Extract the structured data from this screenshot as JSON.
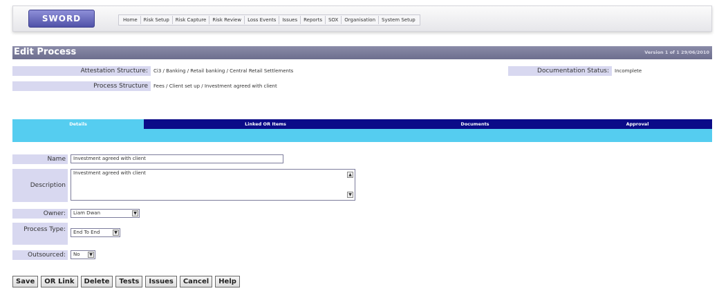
{
  "header": {
    "logo": "SWORD",
    "nav": [
      "Home",
      "Risk Setup",
      "Risk Capture",
      "Risk Review",
      "Loss Events",
      "Issues",
      "Reports",
      "SOX",
      "Organisation",
      "System Setup"
    ]
  },
  "page": {
    "title": "Edit Process",
    "version": "Version 1 of 1 29/06/2010"
  },
  "info": {
    "attestation_label": "Attestation Structure:",
    "attestation_value": "Ci3 / Banking / Retail banking / Central Retail Settlements",
    "process_label": "Process Structure",
    "process_value": "Fees / Client set up / Investment agreed with client",
    "doc_status_label": "Documentation Status:",
    "doc_status_value": "Incomplete"
  },
  "tabs": [
    "Details",
    "Linked OR Items",
    "Documents",
    "Approval"
  ],
  "form": {
    "name_label": "Name",
    "name_value": "Investment agreed with client",
    "description_label": "Description",
    "description_value": "Investment agreed with client",
    "owner_label": "Owner:",
    "owner_value": "Liam Dwan",
    "process_type_label": "Process Type:",
    "process_type_value": "End To End",
    "outsourced_label": "Outsourced:",
    "outsourced_value": "No"
  },
  "buttons": [
    "Save",
    "OR Link",
    "Delete",
    "Tests",
    "Issues",
    "Cancel",
    "Help"
  ]
}
